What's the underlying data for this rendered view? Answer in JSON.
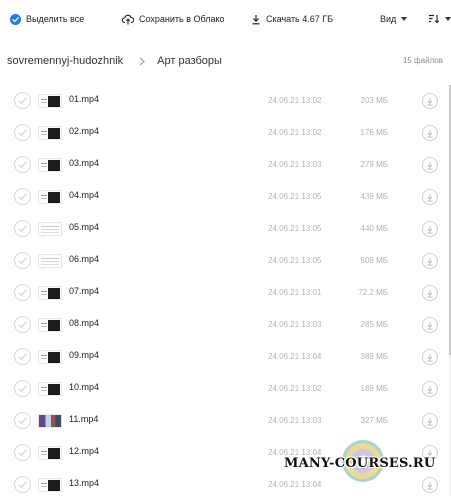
{
  "toolbar": {
    "select_all": "Выделить все",
    "save_to_cloud": "Сохранить в Облако",
    "download": "Скачать 4.67 ГБ",
    "view": "Вид"
  },
  "breadcrumb": {
    "root": "sovremennyj-hudozhnik",
    "current": "Арт разборы"
  },
  "file_count": "15 файлов",
  "files": [
    {
      "name": "01.mp4",
      "date": "24.06.21 13:02",
      "size": "203 МБ",
      "thumb": "dark"
    },
    {
      "name": "02.mp4",
      "date": "24.06.21 13:02",
      "size": "176 МБ",
      "thumb": "dark"
    },
    {
      "name": "03.mp4",
      "date": "24.06.21 13:03",
      "size": "279 МБ",
      "thumb": "dark"
    },
    {
      "name": "04.mp4",
      "date": "24.06.21 13:05",
      "size": "438 МБ",
      "thumb": "dark"
    },
    {
      "name": "05.mp4",
      "date": "24.06.21 13:05",
      "size": "440 МБ",
      "thumb": "light"
    },
    {
      "name": "06.mp4",
      "date": "24.06.21 13:05",
      "size": "508 МБ",
      "thumb": "light"
    },
    {
      "name": "07.mp4",
      "date": "24.06.21 13:01",
      "size": "72.2 МБ",
      "thumb": "dark"
    },
    {
      "name": "08.mp4",
      "date": "24.06.21 13:03",
      "size": "285 МБ",
      "thumb": "dark"
    },
    {
      "name": "09.mp4",
      "date": "24.06.21 13:04",
      "size": "389 МБ",
      "thumb": "dark"
    },
    {
      "name": "10.mp4",
      "date": "24.06.21 13:02",
      "size": "188 МБ",
      "thumb": "dark"
    },
    {
      "name": "11.mp4",
      "date": "24.06.21 13:03",
      "size": "327 МБ",
      "thumb": "photo"
    },
    {
      "name": "12.mp4",
      "date": "24.06.21 13:04",
      "size": "",
      "thumb": "dark"
    },
    {
      "name": "13.mp4",
      "date": "24.06.21 13:04",
      "size": "",
      "thumb": "dark"
    }
  ],
  "watermark": "MANY-COURSES.RU",
  "icons": {
    "select_all": "check-circle-icon",
    "save": "cloud-upload-icon",
    "download": "download-arrow-icon",
    "view": "chevron-down-icon",
    "sort": "sort-icon",
    "breadcrumb_sep": "chevron-right-icon",
    "row_check": "check-circle-icon",
    "row_download": "download-circle-icon"
  },
  "colors": {
    "accent": "#1e7bf2",
    "meta_text": "#b3b3b3",
    "border": "#d8d8d8"
  }
}
